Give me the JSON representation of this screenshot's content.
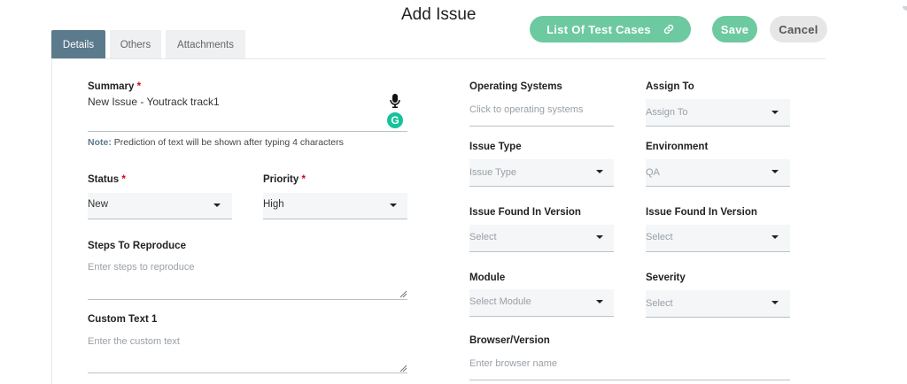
{
  "header": {
    "title": "Add Issue",
    "list_button": "List Of Test Cases",
    "save_button": "Save",
    "cancel_button": "Cancel"
  },
  "tabs": [
    "Details",
    "Others",
    "Attachments"
  ],
  "left": {
    "summary": {
      "label": "Summary",
      "value": "New Issue - Youtrack track1"
    },
    "note": {
      "prefix": "Note:",
      "text": "Prediction of text will be shown after typing 4 characters"
    },
    "status": {
      "label": "Status",
      "value": "New"
    },
    "priority": {
      "label": "Priority",
      "value": "High"
    },
    "steps": {
      "label": "Steps To Reproduce",
      "placeholder": "Enter steps to reproduce"
    },
    "custom": {
      "label": "Custom Text 1",
      "placeholder": "Enter the custom text"
    }
  },
  "right": {
    "os": {
      "label": "Operating Systems",
      "placeholder": "Click to operating systems"
    },
    "assign": {
      "label": "Assign To",
      "value": "Assign To"
    },
    "issue_type": {
      "label": "Issue Type",
      "value": "Issue Type"
    },
    "environment": {
      "label": "Environment",
      "value": "QA"
    },
    "found_version_1": {
      "label": "Issue Found In Version",
      "value": "Select"
    },
    "found_version_2": {
      "label": "Issue Found In Version",
      "value": "Select"
    },
    "module": {
      "label": "Module",
      "value": "Select Module"
    },
    "severity": {
      "label": "Severity",
      "value": "Select"
    },
    "browser": {
      "label": "Browser/Version",
      "placeholder": "Enter browser name"
    }
  },
  "colors": {
    "accent": "#6dc9a0",
    "tab_active": "#5b7a8c",
    "required": "#d0021b"
  },
  "icons": [
    "link-icon",
    "microphone-icon",
    "grammarly-icon",
    "dropdown-caret-icon",
    "resize-handle-icon"
  ]
}
